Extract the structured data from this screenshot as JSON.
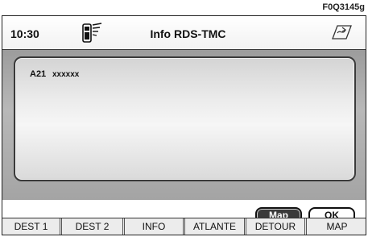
{
  "figure_code": "F0Q3145g",
  "statusbar": {
    "time": "10:30",
    "title": "Info RDS-TMC",
    "phone_icon": "phone-signal-icon",
    "nav_icon": "navigation-icon"
  },
  "message": {
    "road": "A21",
    "text": "xxxxxx"
  },
  "buttons": {
    "map": "Map",
    "ok": "OK"
  },
  "softkeys": [
    "DEST 1",
    "DEST 2",
    "INFO",
    "ATLANTE",
    "DETOUR",
    "MAP"
  ]
}
